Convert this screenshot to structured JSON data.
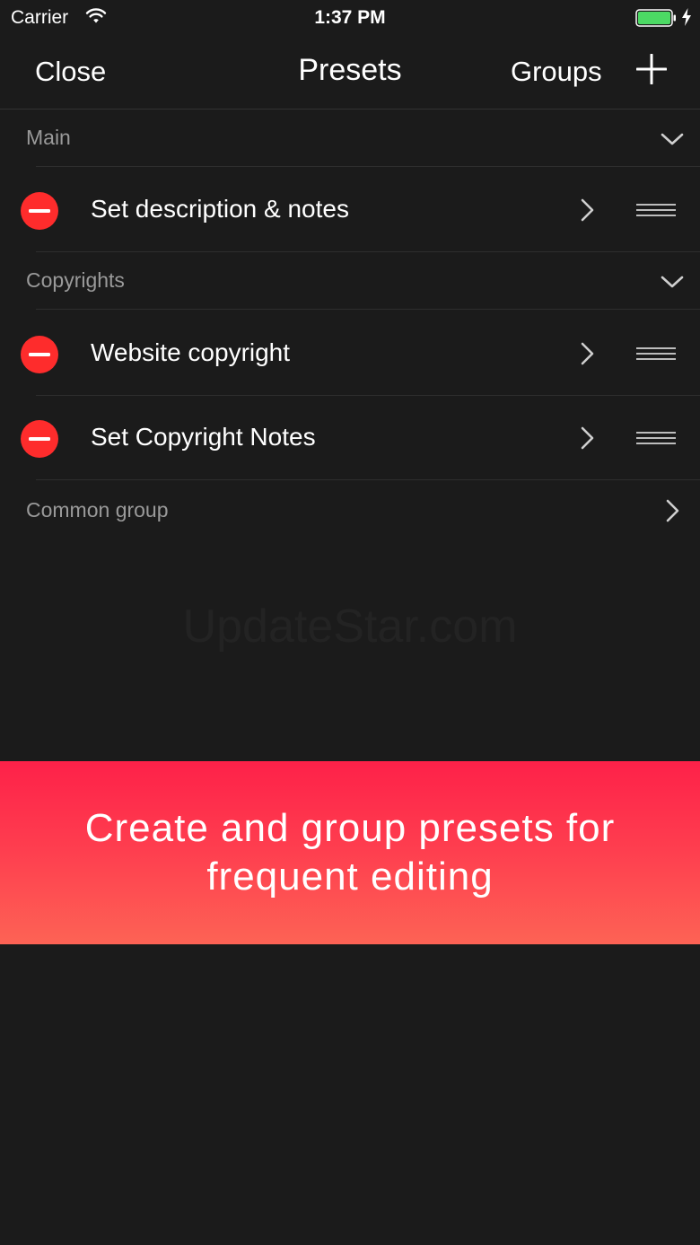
{
  "status_bar": {
    "carrier": "Carrier",
    "time": "1:37 PM",
    "battery_color": "#4cd964"
  },
  "nav": {
    "close_label": "Close",
    "title": "Presets",
    "groups_label": "Groups",
    "add_icon": "plus-icon"
  },
  "sections": [
    {
      "label": "Main",
      "items": [
        {
          "label": "Set description & notes"
        }
      ]
    },
    {
      "label": "Copyrights",
      "items": [
        {
          "label": "Website copyright"
        },
        {
          "label": "Set Copyright Notes"
        }
      ]
    }
  ],
  "common_group": {
    "label": "Common group"
  },
  "watermark": "UpdateStar.com",
  "promo": {
    "text": "Create and group presets for frequent editing"
  },
  "colors": {
    "background": "#1b1b1b",
    "delete_red": "#fe2c2c",
    "banner_top": "#fe2149",
    "banner_bottom": "#fd6355"
  }
}
